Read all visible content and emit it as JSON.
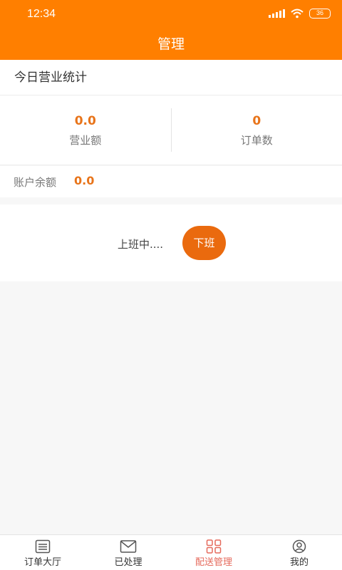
{
  "status_bar": {
    "time": "12:34",
    "battery": "36"
  },
  "header": {
    "title": "管理"
  },
  "stats": {
    "section_title": "今日营业统计",
    "revenue": {
      "value": "0.0",
      "label": "营业额"
    },
    "orders": {
      "value": "0",
      "label": "订单数"
    }
  },
  "balance": {
    "label": "账户余额",
    "value": "0.0"
  },
  "duty": {
    "status_text": "上班中....",
    "button_label": "下班"
  },
  "tabs": [
    {
      "label": "订单大厅",
      "icon": "list-icon",
      "active": false
    },
    {
      "label": "已处理",
      "icon": "mail-icon",
      "active": false
    },
    {
      "label": "配送管理",
      "icon": "grid-icon",
      "active": true
    },
    {
      "label": "我的",
      "icon": "user-icon",
      "active": false
    }
  ],
  "colors": {
    "primary": "#ff7f00",
    "accent": "#e8741a",
    "active_tab": "#e56a5c"
  }
}
